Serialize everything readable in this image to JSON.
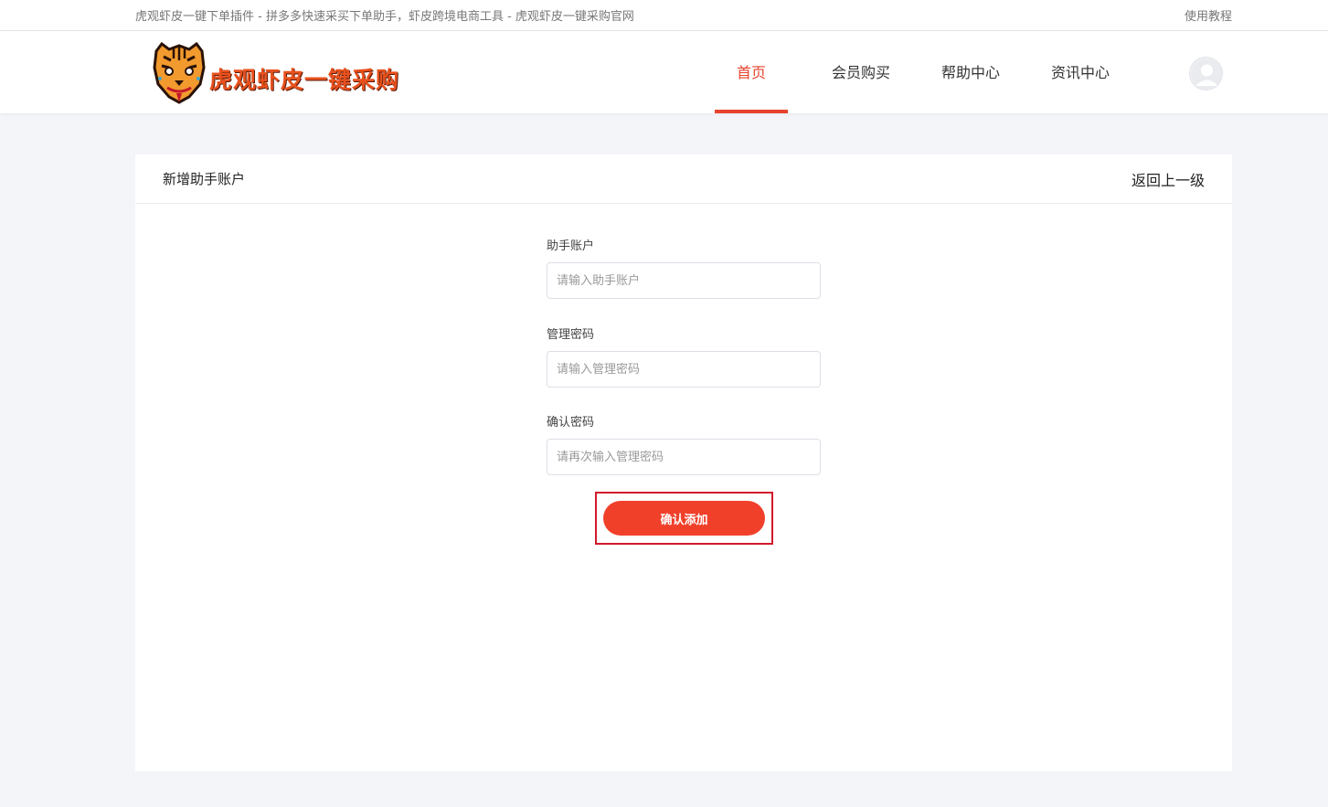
{
  "topbar": {
    "site_title": "虎观虾皮一键下单插件 - 拼多多快速采买下单助手，虾皮跨境电商工具 - 虎观虾皮一键采购官网",
    "tutorial_link": "使用教程"
  },
  "header": {
    "logo_text": "虎观虾皮一键采购",
    "nav": [
      {
        "label": "首页",
        "active": true
      },
      {
        "label": "会员购买",
        "active": false
      },
      {
        "label": "帮助中心",
        "active": false
      },
      {
        "label": "资讯中心",
        "active": false
      }
    ],
    "avatar_icon": "user-avatar-icon"
  },
  "panel": {
    "title": "新增助手账户",
    "back_label": "返回上一级",
    "fields": [
      {
        "label": "助手账户",
        "placeholder": "请输入助手账户",
        "value": ""
      },
      {
        "label": "管理密码",
        "placeholder": "请输入管理密码",
        "value": ""
      },
      {
        "label": "确认密码",
        "placeholder": "请再次输入管理密码",
        "value": ""
      }
    ],
    "submit_label": "确认添加"
  },
  "colors": {
    "accent": "#e8432d",
    "button": "#f0402a",
    "highlight_border": "#d0192b",
    "page_bg": "#f4f5f8"
  }
}
